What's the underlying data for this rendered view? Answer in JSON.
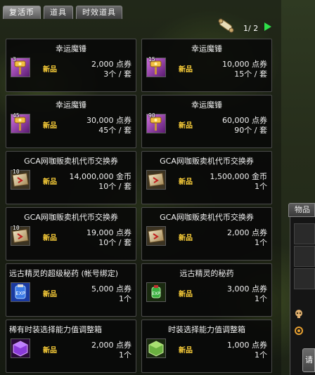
{
  "tabs": [
    {
      "label": "复活币",
      "active": true
    },
    {
      "label": "道具",
      "active": false
    },
    {
      "label": "时效道具",
      "active": false
    }
  ],
  "pagination": {
    "text": "1/ 2"
  },
  "items": [
    {
      "name": "幸运魔锤",
      "icon": "lucky-hammer-icon",
      "icon_qty": "3",
      "badge": "新品",
      "price": "2,000 点券",
      "qty": "3个 / 套"
    },
    {
      "name": "幸运魔锤",
      "icon": "lucky-hammer-icon",
      "icon_qty": "15",
      "badge": "新品",
      "price": "10,000 点券",
      "qty": "15个 / 套"
    },
    {
      "name": "幸运魔锤",
      "icon": "lucky-hammer-icon",
      "icon_qty": "45",
      "badge": "新品",
      "price": "30,000 点券",
      "qty": "45个 / 套"
    },
    {
      "name": "幸运魔锤",
      "icon": "lucky-hammer-icon",
      "icon_qty": "90",
      "badge": "新品",
      "price": "60,000 点券",
      "qty": "90个 / 套"
    },
    {
      "name": "GCA网咖贩卖机代币交换券",
      "icon": "exchange-ticket-icon",
      "icon_qty": "10",
      "badge": "新品",
      "price": "14,000,000 金币",
      "qty": "10个 / 套"
    },
    {
      "name": "GCA网咖贩卖机代币交换券",
      "icon": "exchange-ticket-icon",
      "icon_qty": "",
      "badge": "新品",
      "price": "1,500,000 金币",
      "qty": "1个"
    },
    {
      "name": "GCA网咖贩卖机代币交换券",
      "icon": "exchange-ticket-icon",
      "icon_qty": "10",
      "badge": "新品",
      "price": "19,000 点券",
      "qty": "10个 / 套"
    },
    {
      "name": "GCA网咖贩卖机代币交换券",
      "icon": "exchange-ticket-icon",
      "icon_qty": "",
      "badge": "新品",
      "price": "2,000 点券",
      "qty": "1个"
    },
    {
      "name": "远古精灵的超级秘药 (帐号绑定)",
      "icon": "super-elixir-icon",
      "icon_qty": "",
      "badge": "新品",
      "price": "5,000 点券",
      "qty": "1个"
    },
    {
      "name": "远古精灵的秘药",
      "icon": "elixir-icon",
      "icon_qty": "",
      "badge": "新品",
      "price": "3,000 点券",
      "qty": "1个"
    },
    {
      "name": "稀有时装选择能力值调整箱",
      "icon": "rare-box-icon",
      "icon_qty": "",
      "badge": "新品",
      "price": "2,000 点券",
      "qty": "1个"
    },
    {
      "name": "时装选择能力值调整箱",
      "icon": "box-icon",
      "icon_qty": "",
      "badge": "新品",
      "price": "1,000 点券",
      "qty": "1个"
    }
  ],
  "side": {
    "tab_label": "物品",
    "button_label": "请"
  }
}
